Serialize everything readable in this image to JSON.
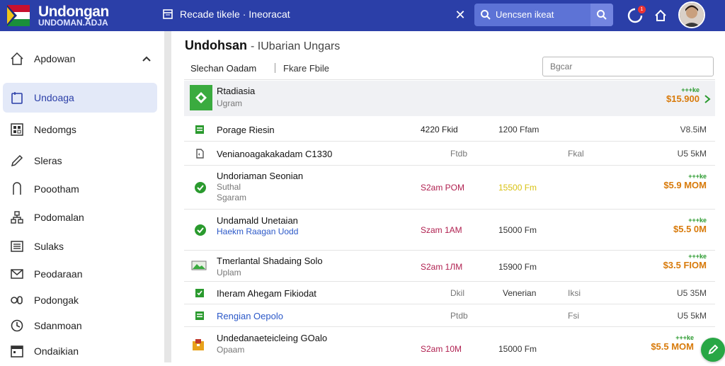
{
  "app": {
    "name": "Undongan",
    "subtitle": "UNDOMAN.ADJA"
  },
  "breadcrumb": {
    "text": "Recade tikele · Ineoracat"
  },
  "search": {
    "placeholder": "Uencsen ikeat"
  },
  "notifications": {
    "count": "1"
  },
  "sidebar": {
    "items": [
      {
        "label": "Apdowan",
        "icon": "home-icon"
      },
      {
        "label": "Undoaga",
        "icon": "document-icon"
      },
      {
        "label": "Nedomgs",
        "icon": "grid-icon"
      },
      {
        "label": "Sleras",
        "icon": "pen-icon"
      },
      {
        "label": "Poootham",
        "icon": "bookmark-icon"
      },
      {
        "label": "Podomalan",
        "icon": "org-chart-icon"
      },
      {
        "label": "Sulaks",
        "icon": "list-icon"
      },
      {
        "label": "Peodaraan",
        "icon": "mail-icon"
      },
      {
        "label": "Podongak",
        "icon": "link-icon"
      },
      {
        "label": "Sdanmoan",
        "icon": "clock-icon"
      },
      {
        "label": "Ondaikian",
        "icon": "calendar-icon"
      }
    ]
  },
  "page": {
    "title": "Undohsan",
    "subtitle": "- IUbarian Ungars",
    "tabs": [
      "Slechan Oadam",
      "Fkare Fbile"
    ],
    "filter_placeholder": "Bgcar"
  },
  "rows": [
    {
      "name": "Rtadiasia",
      "sub": "Ugram",
      "tag": "+++ke",
      "price": "$15.900"
    },
    {
      "name": "Porage Riesin",
      "c1": "4220 Fkid",
      "c2": "1200 Ffam",
      "size": "V8.5iM"
    },
    {
      "name": "Venianoagakakadam C1330",
      "c1": "Ftdb",
      "c3": "Fkal",
      "size": "U5 5kM"
    },
    {
      "name": "Undoriaman Seonian",
      "sub": "Suthal",
      "sub2": "Sgaram",
      "c1": "S2am POM",
      "c2": "15500 Fm",
      "tag": "+++ke",
      "price": "$5.9 MOM"
    },
    {
      "name": "Undamald Unetaian",
      "sub": "Haekm Raagan Uodd",
      "c1": "Szam 1AM",
      "c2": "15000 Fm",
      "tag": "+++ke",
      "price": "$5.5 0M"
    },
    {
      "name": "Tmerlantal Shadaing Solo",
      "sub": "Uplam",
      "c1": "S2am 1ЛM",
      "c2": "15900 Fm",
      "tag": "+++ke",
      "price": "$3.5 FIOM"
    },
    {
      "name": "Iheram Ahegam Fikiodat",
      "c1": "Dkil",
      "c2": "Venerian",
      "c3": "Iksi",
      "size": "U5 35M"
    },
    {
      "name": "Rengian Oepolo",
      "c1": "Ptdb",
      "c3": "Fsi",
      "size": "U5 5kM"
    },
    {
      "name": "Undedanaeteicleing GOalo",
      "sub": "Opaam",
      "c1": "S2am 10M",
      "c2": "15000 Fm",
      "tag": "+++ke",
      "price": "$5.5 MOM"
    }
  ]
}
